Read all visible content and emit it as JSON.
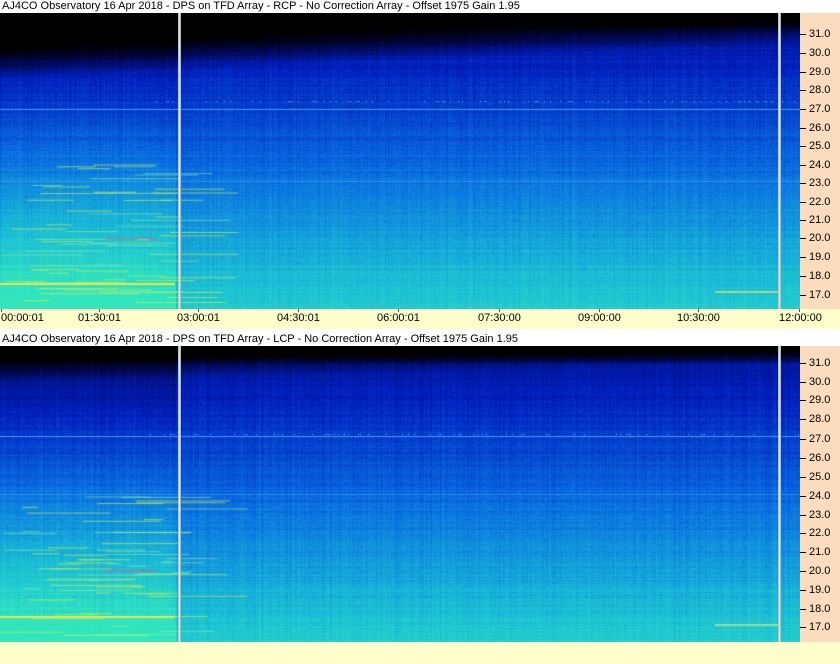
{
  "panels": [
    {
      "id": "rcp",
      "title": "AJ4CO Observatory 16 Apr 2018 - DPS on TFD Array  - RCP  -  No Correction Array  -  Offset 1975  Gain 1.95",
      "y_labels": [
        "31.0",
        "30.0",
        "29.0",
        "28.0",
        "27.0",
        "26.0",
        "25.0",
        "24.0",
        "23.0",
        "22.0",
        "21.0",
        "20.0",
        "19.0",
        "18.0",
        "17.0"
      ]
    },
    {
      "id": "lcp",
      "title": "AJ4CO Observatory 16 Apr 2018 - DPS on TFD Array  - LCP  -  No Correction Array  -  Offset 1975  Gain 1.95",
      "y_labels": [
        "31.0",
        "30.0",
        "29.0",
        "28.0",
        "27.0",
        "26.0",
        "25.0",
        "24.0",
        "23.0",
        "22.0",
        "21.0",
        "20.0",
        "19.0",
        "18.0",
        "17.0"
      ]
    }
  ],
  "time_labels": [
    "00:00:01",
    "01:30:01",
    "03:00:01",
    "04:30:01",
    "06:00:01",
    "07:30:00",
    "09:00:00",
    "10:30:00",
    "12:00:00"
  ],
  "colors": {
    "axis_bg": "#fcdcbf",
    "time_bg": "#ffffcc",
    "spectrum_low": "#000000",
    "spectrum_high": "#2fe0c8"
  }
}
